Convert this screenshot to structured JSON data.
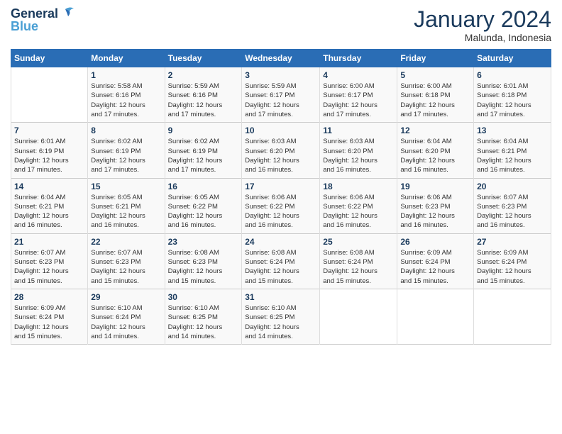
{
  "header": {
    "logo_line1": "General",
    "logo_line2": "Blue",
    "month": "January 2024",
    "location": "Malunda, Indonesia"
  },
  "days_of_week": [
    "Sunday",
    "Monday",
    "Tuesday",
    "Wednesday",
    "Thursday",
    "Friday",
    "Saturday"
  ],
  "weeks": [
    [
      {
        "day": "",
        "info": ""
      },
      {
        "day": "1",
        "info": "Sunrise: 5:58 AM\nSunset: 6:16 PM\nDaylight: 12 hours\nand 17 minutes."
      },
      {
        "day": "2",
        "info": "Sunrise: 5:59 AM\nSunset: 6:16 PM\nDaylight: 12 hours\nand 17 minutes."
      },
      {
        "day": "3",
        "info": "Sunrise: 5:59 AM\nSunset: 6:17 PM\nDaylight: 12 hours\nand 17 minutes."
      },
      {
        "day": "4",
        "info": "Sunrise: 6:00 AM\nSunset: 6:17 PM\nDaylight: 12 hours\nand 17 minutes."
      },
      {
        "day": "5",
        "info": "Sunrise: 6:00 AM\nSunset: 6:18 PM\nDaylight: 12 hours\nand 17 minutes."
      },
      {
        "day": "6",
        "info": "Sunrise: 6:01 AM\nSunset: 6:18 PM\nDaylight: 12 hours\nand 17 minutes."
      }
    ],
    [
      {
        "day": "7",
        "info": "Sunrise: 6:01 AM\nSunset: 6:19 PM\nDaylight: 12 hours\nand 17 minutes."
      },
      {
        "day": "8",
        "info": "Sunrise: 6:02 AM\nSunset: 6:19 PM\nDaylight: 12 hours\nand 17 minutes."
      },
      {
        "day": "9",
        "info": "Sunrise: 6:02 AM\nSunset: 6:19 PM\nDaylight: 12 hours\nand 17 minutes."
      },
      {
        "day": "10",
        "info": "Sunrise: 6:03 AM\nSunset: 6:20 PM\nDaylight: 12 hours\nand 16 minutes."
      },
      {
        "day": "11",
        "info": "Sunrise: 6:03 AM\nSunset: 6:20 PM\nDaylight: 12 hours\nand 16 minutes."
      },
      {
        "day": "12",
        "info": "Sunrise: 6:04 AM\nSunset: 6:20 PM\nDaylight: 12 hours\nand 16 minutes."
      },
      {
        "day": "13",
        "info": "Sunrise: 6:04 AM\nSunset: 6:21 PM\nDaylight: 12 hours\nand 16 minutes."
      }
    ],
    [
      {
        "day": "14",
        "info": "Sunrise: 6:04 AM\nSunset: 6:21 PM\nDaylight: 12 hours\nand 16 minutes."
      },
      {
        "day": "15",
        "info": "Sunrise: 6:05 AM\nSunset: 6:21 PM\nDaylight: 12 hours\nand 16 minutes."
      },
      {
        "day": "16",
        "info": "Sunrise: 6:05 AM\nSunset: 6:22 PM\nDaylight: 12 hours\nand 16 minutes."
      },
      {
        "day": "17",
        "info": "Sunrise: 6:06 AM\nSunset: 6:22 PM\nDaylight: 12 hours\nand 16 minutes."
      },
      {
        "day": "18",
        "info": "Sunrise: 6:06 AM\nSunset: 6:22 PM\nDaylight: 12 hours\nand 16 minutes."
      },
      {
        "day": "19",
        "info": "Sunrise: 6:06 AM\nSunset: 6:23 PM\nDaylight: 12 hours\nand 16 minutes."
      },
      {
        "day": "20",
        "info": "Sunrise: 6:07 AM\nSunset: 6:23 PM\nDaylight: 12 hours\nand 16 minutes."
      }
    ],
    [
      {
        "day": "21",
        "info": "Sunrise: 6:07 AM\nSunset: 6:23 PM\nDaylight: 12 hours\nand 15 minutes."
      },
      {
        "day": "22",
        "info": "Sunrise: 6:07 AM\nSunset: 6:23 PM\nDaylight: 12 hours\nand 15 minutes."
      },
      {
        "day": "23",
        "info": "Sunrise: 6:08 AM\nSunset: 6:23 PM\nDaylight: 12 hours\nand 15 minutes."
      },
      {
        "day": "24",
        "info": "Sunrise: 6:08 AM\nSunset: 6:24 PM\nDaylight: 12 hours\nand 15 minutes."
      },
      {
        "day": "25",
        "info": "Sunrise: 6:08 AM\nSunset: 6:24 PM\nDaylight: 12 hours\nand 15 minutes."
      },
      {
        "day": "26",
        "info": "Sunrise: 6:09 AM\nSunset: 6:24 PM\nDaylight: 12 hours\nand 15 minutes."
      },
      {
        "day": "27",
        "info": "Sunrise: 6:09 AM\nSunset: 6:24 PM\nDaylight: 12 hours\nand 15 minutes."
      }
    ],
    [
      {
        "day": "28",
        "info": "Sunrise: 6:09 AM\nSunset: 6:24 PM\nDaylight: 12 hours\nand 15 minutes."
      },
      {
        "day": "29",
        "info": "Sunrise: 6:10 AM\nSunset: 6:24 PM\nDaylight: 12 hours\nand 14 minutes."
      },
      {
        "day": "30",
        "info": "Sunrise: 6:10 AM\nSunset: 6:25 PM\nDaylight: 12 hours\nand 14 minutes."
      },
      {
        "day": "31",
        "info": "Sunrise: 6:10 AM\nSunset: 6:25 PM\nDaylight: 12 hours\nand 14 minutes."
      },
      {
        "day": "",
        "info": ""
      },
      {
        "day": "",
        "info": ""
      },
      {
        "day": "",
        "info": ""
      }
    ]
  ]
}
